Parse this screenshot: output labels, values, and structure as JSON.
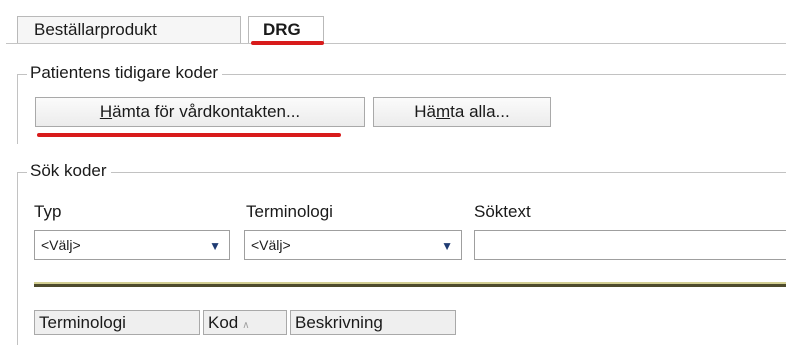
{
  "tabs": [
    {
      "label": "Beställarprodukt",
      "active": false
    },
    {
      "label": "DRG",
      "active": true
    }
  ],
  "previous_codes": {
    "legend": "Patientens tidigare koder",
    "btn_fetch_contact": {
      "mnemonic": "H",
      "rest": "ämta för vårdkontakten..."
    },
    "btn_fetch_all": {
      "pre": "Hä",
      "mnemonic": "m",
      "rest": "ta alla..."
    }
  },
  "search": {
    "legend": "Sök koder",
    "type_label": "Typ",
    "type_value": "<Välj>",
    "terminology_label": "Terminologi",
    "terminology_value": "<Välj>",
    "searchtext_label": "Söktext",
    "searchtext_value": ""
  },
  "results": {
    "columns": [
      {
        "label": "Terminologi",
        "sort": ""
      },
      {
        "label": "Kod",
        "sort": "ascending"
      },
      {
        "label": "Beskrivning",
        "sort": ""
      }
    ]
  },
  "colors": {
    "highlight_underline": "#d81b1b",
    "caret": "#1f3b73",
    "separator_dark": "#4e4b2c",
    "separator_light": "#d3cf93"
  },
  "icons": {
    "dropdown": "triangle-down-icon",
    "sort": "sort-ascending-icon"
  }
}
